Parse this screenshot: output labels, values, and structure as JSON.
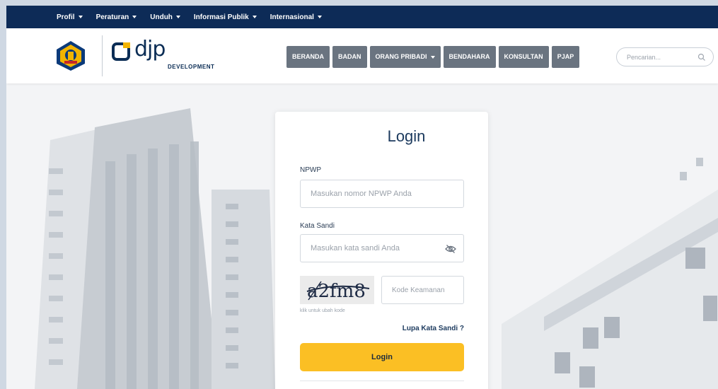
{
  "topnav": {
    "items": [
      {
        "label": "Profil"
      },
      {
        "label": "Peraturan"
      },
      {
        "label": "Unduh"
      },
      {
        "label": "Informasi Publik"
      },
      {
        "label": "Internasional"
      }
    ]
  },
  "header": {
    "logo_text": "djp",
    "logo_sub": "DEVELOPMENT",
    "menu": [
      {
        "label": "BERANDA",
        "dropdown": false
      },
      {
        "label": "BADAN",
        "dropdown": false
      },
      {
        "label": "ORANG PRIBADI",
        "dropdown": true
      },
      {
        "label": "BENDAHARA",
        "dropdown": false
      },
      {
        "label": "KONSULTAN",
        "dropdown": false
      },
      {
        "label": "PJAP",
        "dropdown": false
      }
    ],
    "search_placeholder": "Pencarian..."
  },
  "login": {
    "title": "Login",
    "npwp_label": "NPWP",
    "npwp_placeholder": "Masukan nomor NPWP Anda",
    "password_label": "Kata Sandi",
    "password_placeholder": "Masukan kata sandi Anda",
    "captcha_text": "a2fm8",
    "captcha_hint": "klik untuk ubah kode",
    "code_placeholder": "Kode Keamanan",
    "forgot_label": "Lupa Kata Sandi ?",
    "submit_label": "Login"
  },
  "colors": {
    "topnav_bg": "#0d2b57",
    "menu_button_bg": "#6a7480",
    "login_button_bg": "#fbbf24"
  }
}
